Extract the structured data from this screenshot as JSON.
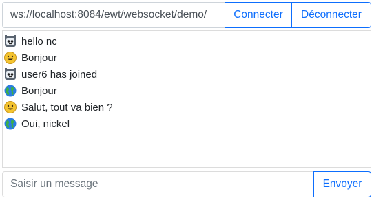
{
  "connection": {
    "url_value": "ws://localhost:8084/ewt/websocket/demo/",
    "connect_label": "Connecter",
    "disconnect_label": "Déconnecter"
  },
  "messages": [
    {
      "avatar": "robot-icon",
      "text": "hello nc"
    },
    {
      "avatar": "smiley-icon",
      "text": "Bonjour"
    },
    {
      "avatar": "robot-icon",
      "text": "user6 has joined"
    },
    {
      "avatar": "globe-icon",
      "text": "Bonjour"
    },
    {
      "avatar": "smiley-icon",
      "text": "Salut, tout va bien ?"
    },
    {
      "avatar": "globe-icon",
      "text": "Oui, nickel"
    }
  ],
  "composer": {
    "placeholder": "Saisir un message",
    "value": "",
    "send_label": "Envoyer"
  },
  "colors": {
    "accent": "#0d6efd",
    "border": "#ced4da"
  }
}
